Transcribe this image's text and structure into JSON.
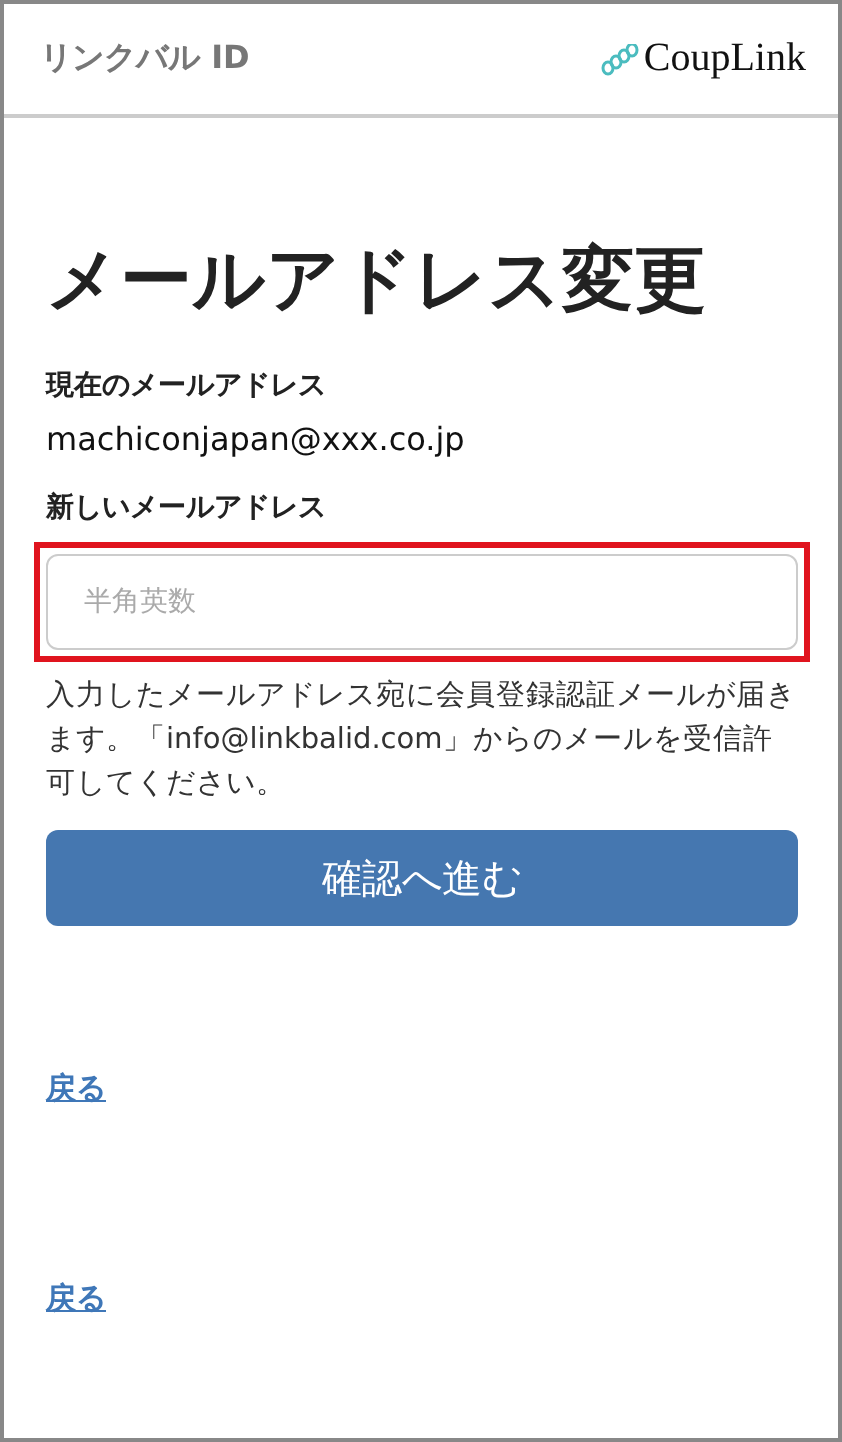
{
  "header": {
    "title": "リンクバル ID",
    "logo_text": "CoupLink"
  },
  "heading": "メールアドレス変更",
  "current_email": {
    "label": "現在のメールアドレス",
    "value": "machiconjapan@xxx.co.jp"
  },
  "new_email": {
    "label": "新しいメールアドレス",
    "placeholder": "半角英数",
    "highlighted": true
  },
  "notice": "入力したメールアドレス宛に会員登録認証メールが届きます。「info@linkbalid.com」からのメールを受信許可してください。",
  "submit_button": "確認へ進む",
  "links": [
    "戻る",
    "戻る"
  ]
}
